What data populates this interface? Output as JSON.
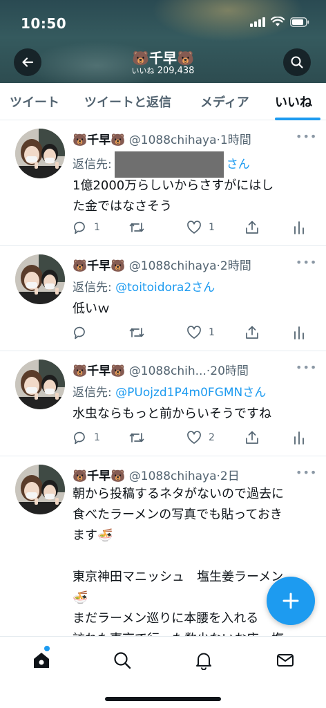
{
  "status_bar": {
    "time": "10:50"
  },
  "header": {
    "title": "🐻千早🐻",
    "likes_label": "いいね",
    "likes_count": "209,438"
  },
  "tabs": [
    {
      "label": "ツイート"
    },
    {
      "label": "ツイートと返信"
    },
    {
      "label": "メディア"
    },
    {
      "label": "いいね"
    }
  ],
  "tweets": [
    {
      "name": "🐻千早🐻",
      "handle": "@1088chihaya",
      "time": "·1時間",
      "reply_prefix": "返信先:",
      "reply_to": "",
      "reply_suffix": "さん",
      "text_lines": [
        "1億2000万らしいからさすがにはし",
        "た金ではなさそう"
      ],
      "replies": "1",
      "retweets": "",
      "likes": "1"
    },
    {
      "name": "🐻千早🐻",
      "handle": "@1088chihaya",
      "time": "·2時間",
      "reply_prefix": "返信先:",
      "reply_to": "@toitoidora2",
      "reply_suffix": "さん",
      "text_lines": [
        "低いｗ"
      ],
      "replies": "",
      "retweets": "",
      "likes": "1"
    },
    {
      "name": "🐻千早🐻",
      "handle": "@1088chih...",
      "time": "·20時間",
      "reply_prefix": "返信先:",
      "reply_to": "@PUojzd1P4m0FGMN",
      "reply_suffix": "さん",
      "text_lines": [
        "水虫ならもっと前からいそうですね"
      ],
      "replies": "1",
      "retweets": "",
      "likes": "2"
    },
    {
      "name": "🐻千早🐻",
      "handle": "@1088chihaya",
      "time": "·2日",
      "text_lines": [
        "朝から投稿するネタがないので過去に",
        "食べたラーメンの写真でも貼っておき",
        "ます🍜",
        "",
        "東京神田マニッシュ　塩生姜ラーメン",
        "🍜",
        "まだラーメン巡りに本腰を入れる",
        "訪れた東京で行った数少ないお店。塩"
      ]
    }
  ],
  "colors": {
    "accent": "#1d9bf0",
    "text": "#0f1419",
    "muted": "#536471"
  },
  "icons": [
    "back-arrow-icon",
    "search-icon",
    "reply-icon",
    "retweet-icon",
    "like-icon",
    "share-icon",
    "analytics-icon",
    "compose-icon",
    "home-icon",
    "explore-icon",
    "notifications-icon",
    "messages-icon"
  ]
}
